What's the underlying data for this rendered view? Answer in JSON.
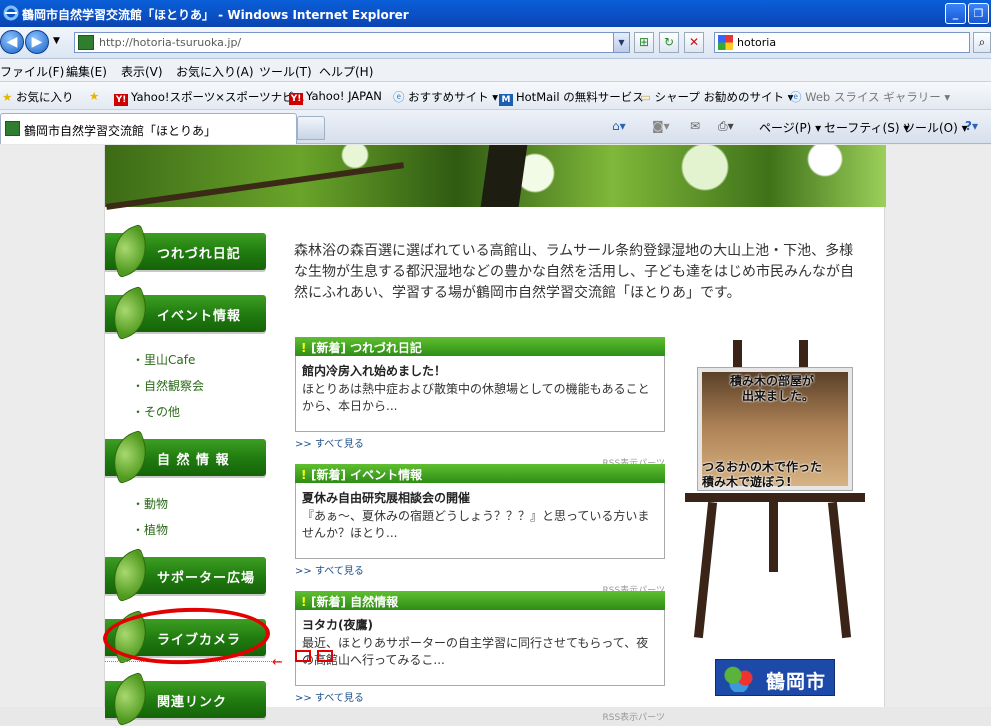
{
  "window": {
    "title": "鶴岡市自然学習交流館「ほとりあ」 - Windows Internet Explorer"
  },
  "address": {
    "url": "http://hotoria-tsuruoka.jp/"
  },
  "search": {
    "value": "hotoria"
  },
  "menu": [
    "ファイル(F)",
    "編集(E)",
    "表示(V)",
    "お気に入り(A)",
    "ツール(T)",
    "ヘルプ(H)"
  ],
  "favorites": {
    "label": "お気に入り",
    "items": [
      "Yahoo!スポーツ×スポーツナビ...",
      "Yahoo! JAPAN",
      "おすすめサイト ▾",
      "HotMail の無料サービス",
      "シャープ お勧めのサイト ▾",
      "Web スライス ギャラリー ▾"
    ]
  },
  "tab": {
    "label": "鶴岡市自然学習交流館「ほとりあ」"
  },
  "toolbar": {
    "page": "ページ(P) ▾",
    "safety": "セーフティ(S) ▾",
    "tools": "ツール(O) ▾"
  },
  "nav": [
    "つれづれ日記",
    "イベント情報",
    "自 然 情 報",
    "サポーター広場",
    "ライブカメラ",
    "関連リンク"
  ],
  "event_sub": [
    "里山Cafe",
    "自然観察会",
    "その他"
  ],
  "nature_sub": [
    "動物",
    "植物"
  ],
  "intro": "森林浴の森百選に選ばれている高館山、ラムサール条約登録湿地の大山上池・下池、多様な生物が生息する都沢湿地などの豊かな自然を活用し、子ども達をはじめ市民みんなが自然にふれあい、学習する場が鶴岡市自然学習交流館「ほとりあ」です。",
  "boxes": [
    {
      "header": "[新着] つれづれ日記",
      "title": "館内冷房入れ始めました！",
      "excerpt": "ほとりあは熱中症および散策中の休憩場としての機能もあることから、本日から...",
      "more": ">> すべて見る",
      "rss": "RSS表示パーツ"
    },
    {
      "header": "[新着] イベント情報",
      "title": "夏休み自由研究展相談会の開催",
      "excerpt": "『あぁ〜、夏休みの宿題どうしょう？？？』と思っている方いませんか？ほとり...",
      "more": ">> すべて見る",
      "rss": "RSS表示パーツ"
    },
    {
      "header": "[新着] 自然情報",
      "title": "ヨタカ(夜鷹)",
      "excerpt": "最近、ほとりあサポーターの自主学習に同行させてもらって、夜の高館山へ行ってみるこ...",
      "more": ">> すべて見る",
      "rss": "RSS表示パーツ"
    }
  ],
  "easel": {
    "caption_top": "積み木の部屋が\n出来ました。",
    "caption_bottom": "つるおかの木で作った\n積み木で遊ぼう!"
  },
  "logo": {
    "name": "鶴岡市"
  },
  "annotation": {
    "arrow": "←"
  }
}
